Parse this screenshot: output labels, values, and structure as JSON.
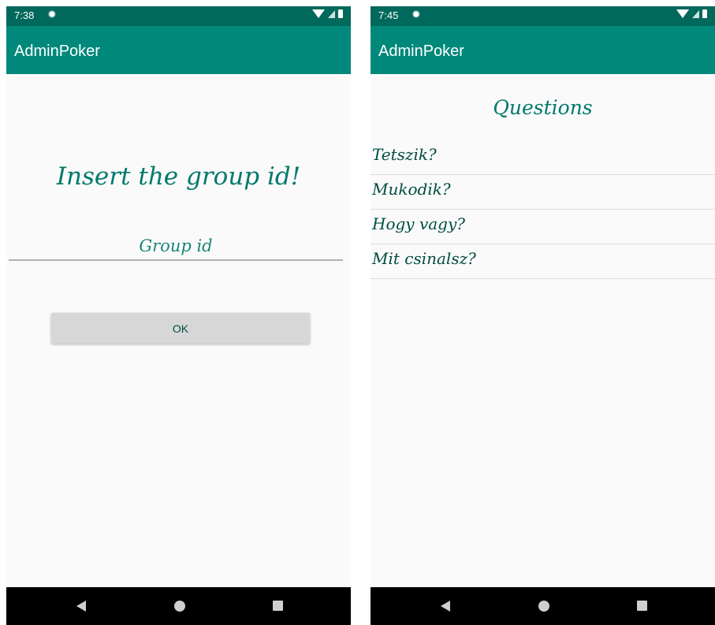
{
  "left_screen": {
    "status": {
      "time": "7:38"
    },
    "app_title": "AdminPoker",
    "prompt": "Insert the group id!",
    "group_input": {
      "placeholder": "Group id",
      "value": ""
    },
    "ok_label": "OK"
  },
  "right_screen": {
    "status": {
      "time": "7:45"
    },
    "app_title": "AdminPoker",
    "questions_title": "Questions",
    "questions": [
      "Tetszik?",
      "Mukodik?",
      "Hogy vagy?",
      "Mit csinalsz?"
    ]
  },
  "icons": {
    "status": [
      "gear-icon",
      "wifi-icon",
      "signal-icon",
      "battery-icon"
    ],
    "navigation": [
      "back-icon",
      "home-icon",
      "recents-icon"
    ]
  },
  "colors": {
    "status_bar": "#00695c",
    "app_bar": "#00897b",
    "accent_text": "#00796b",
    "button": "#d7d7d7",
    "background": "#fafafa",
    "nav_bar": "#000000"
  }
}
